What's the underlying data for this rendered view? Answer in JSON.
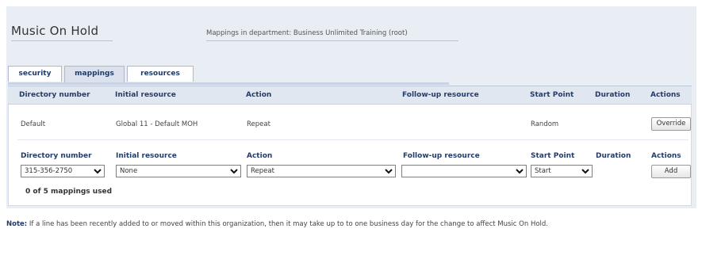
{
  "header": {
    "title": "Music On Hold",
    "subtitle": "Mappings in department: Business Unlimited Training (root)"
  },
  "tabs": [
    {
      "label": "security",
      "active": false
    },
    {
      "label": "mappings",
      "active": true
    },
    {
      "label": "resources",
      "active": false
    }
  ],
  "table": {
    "columns": [
      "Directory number",
      "Initial resource",
      "Action",
      "Follow-up resource",
      "Start Point",
      "Duration",
      "Actions"
    ],
    "rows": [
      {
        "directory_number": "Default",
        "initial_resource": "Global 11 - Default MOH",
        "action": "Repeat",
        "followup_resource": "",
        "start_point": "Random",
        "duration": "",
        "action_button": "Override"
      }
    ]
  },
  "add_form": {
    "headers": [
      "Directory number",
      "Initial resource",
      "Action",
      "Follow-up resource",
      "Start Point",
      "Duration",
      "Actions"
    ],
    "directory_number": "315-356-2750",
    "initial_resource": "None",
    "action": "Repeat",
    "followup_resource": "",
    "start_point": "Start",
    "add_button": "Add"
  },
  "usage": "0 of 5 mappings used",
  "note": {
    "label": "Note:",
    "text": " If a line has been recently added to or moved within this organization, then it may take up to to one business day for the change to affect Music On Hold."
  }
}
